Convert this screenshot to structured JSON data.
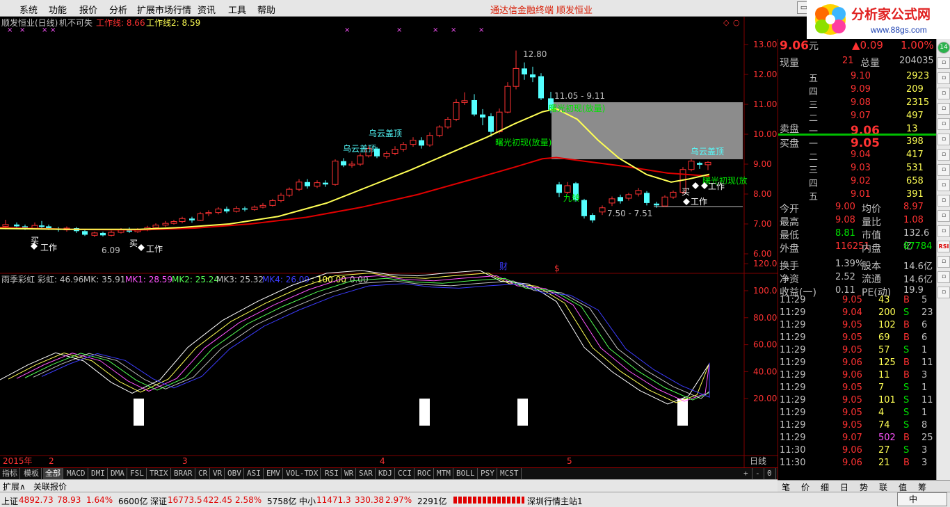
{
  "menu": [
    "系统",
    "功能",
    "报价",
    "分析",
    "扩展市场行情",
    "资讯",
    "工具",
    "帮助"
  ],
  "center_links": [
    "通达信金融终端",
    "顺发恒业"
  ],
  "window_button": "行",
  "logo": {
    "text": "分析家公式网",
    "url": "www.88gs.com"
  },
  "price_chart": {
    "header_name": "顺发恒业(日线)",
    "header_formula": "机不可失",
    "line1_label": "工作线: 8.66",
    "line2_label": "工作线2: 8.59",
    "y_ticks": [
      "13.00",
      "12.00",
      "11.00",
      "10.00",
      "9.00",
      "8.00",
      "7.00",
      "6.00"
    ],
    "annotations": {
      "high": "12.80",
      "low_left": "6.09",
      "range_top": "11.05 - 9.11",
      "range_bottom": "7.50 - 7.51",
      "cloud": "乌云盖顶",
      "dawn": "曙光初现(放量)",
      "dawn_short": "曙光初现(放",
      "work": "工作",
      "buy": "买",
      "nine": "九转"
    },
    "markers": [
      "财",
      "$"
    ],
    "colors": {
      "up": "#ff3232",
      "down": "#54ffff",
      "ma1": "#ffff54",
      "ma2": "#e00000"
    }
  },
  "rainbow": {
    "title": "雨季彩虹",
    "caihong": "彩虹: 46.96",
    "mk": "MK: 35.91",
    "mk1": "MK1: 28.59",
    "mk2": "MK2: 25.24",
    "mk3": "MK3: 25.32",
    "mk4": "MK4: 26.09",
    "lv1": ": 100.00",
    "lv2": ": 0.00",
    "y_ticks": [
      "120.00",
      "100.00",
      "80.00",
      "60.00",
      "40.00",
      "20.00"
    ]
  },
  "timeline": {
    "year": "2015年",
    "months": [
      "2",
      "3",
      "4",
      "5"
    ],
    "period": "日线"
  },
  "indicator_tabs": [
    "指标",
    "模板",
    "全部",
    "MACD",
    "DMI",
    "DMA",
    "FSL",
    "TRIX",
    "BRAR",
    "CR",
    "VR",
    "OBV",
    "ASI",
    "EMV",
    "VOL-TDX",
    "RSI",
    "WR",
    "SAR",
    "KDJ",
    "CCI",
    "ROC",
    "MTM",
    "BOLL",
    "PSY",
    "MCST"
  ],
  "tab_controls": [
    "+",
    "-",
    "0"
  ],
  "ext_tabs": [
    "扩展∧",
    "关联报价"
  ],
  "quote": {
    "price": "9.06",
    "unit": "元",
    "change": "▲0.09",
    "pct": "1.00%",
    "now_vol_label": "现量",
    "now_vol": "21",
    "total_vol_label": "总量",
    "total_vol": "204035",
    "sell_label": "卖盘",
    "buy_label": "买盘",
    "asks": [
      {
        "lvl": "五",
        "price": "9.10",
        "vol": "2923"
      },
      {
        "lvl": "四",
        "price": "9.09",
        "vol": "209"
      },
      {
        "lvl": "三",
        "price": "9.08",
        "vol": "2315"
      },
      {
        "lvl": "二",
        "price": "9.07",
        "vol": "497"
      },
      {
        "lvl": "一",
        "price": "9.06",
        "vol": "13"
      }
    ],
    "bids": [
      {
        "lvl": "一",
        "price": "9.05",
        "vol": "398"
      },
      {
        "lvl": "二",
        "price": "9.04",
        "vol": "417"
      },
      {
        "lvl": "三",
        "price": "9.03",
        "vol": "531"
      },
      {
        "lvl": "四",
        "price": "9.02",
        "vol": "658"
      },
      {
        "lvl": "五",
        "price": "9.01",
        "vol": "391"
      }
    ],
    "stats": [
      {
        "l1": "今开",
        "v1": "9.00",
        "l2": "均价",
        "v2": "8.97",
        "c1": "#ff3232",
        "c2": "#ff3232"
      },
      {
        "l1": "最高",
        "v1": "9.08",
        "l2": "量比",
        "v2": "1.08",
        "c1": "#ff3232",
        "c2": "#ff3232"
      },
      {
        "l1": "最低",
        "v1": "8.81",
        "l2": "市值",
        "v2": "132.6亿",
        "c1": "#00e600",
        "c2": "#c0c0c0"
      },
      {
        "l1": "外盘",
        "v1": "116251",
        "l2": "内盘",
        "v2": "87784",
        "c1": "#ff3232",
        "c2": "#00e600"
      },
      {
        "l1": "换手",
        "v1": "1.39%",
        "l2": "股本",
        "v2": "14.6亿",
        "c1": "#c0c0c0",
        "c2": "#c0c0c0"
      },
      {
        "l1": "净资",
        "v1": "2.52",
        "l2": "流通",
        "v2": "14.6亿",
        "c1": "#c0c0c0",
        "c2": "#c0c0c0"
      },
      {
        "l1": "收益(一)",
        "v1": "0.11",
        "l2": "PE(动)",
        "v2": "19.9",
        "c1": "#c0c0c0",
        "c2": "#c0c0c0"
      }
    ],
    "ticks": [
      {
        "t": "11:29",
        "p": "9.05",
        "v": "43",
        "bs": "B",
        "n": "5"
      },
      {
        "t": "11:29",
        "p": "9.04",
        "v": "200",
        "bs": "S",
        "n": "23"
      },
      {
        "t": "11:29",
        "p": "9.05",
        "v": "102",
        "bs": "B",
        "n": "6"
      },
      {
        "t": "11:29",
        "p": "9.05",
        "v": "69",
        "bs": "B",
        "n": "6"
      },
      {
        "t": "11:29",
        "p": "9.05",
        "v": "57",
        "bs": "S",
        "n": "1"
      },
      {
        "t": "11:29",
        "p": "9.06",
        "v": "125",
        "bs": "B",
        "n": "11"
      },
      {
        "t": "11:29",
        "p": "9.06",
        "v": "11",
        "bs": "B",
        "n": "3"
      },
      {
        "t": "11:29",
        "p": "9.05",
        "v": "7",
        "bs": "S",
        "n": "1"
      },
      {
        "t": "11:29",
        "p": "9.05",
        "v": "101",
        "bs": "S",
        "n": "11"
      },
      {
        "t": "11:29",
        "p": "9.05",
        "v": "4",
        "bs": "S",
        "n": "1"
      },
      {
        "t": "11:29",
        "p": "9.05",
        "v": "74",
        "bs": "S",
        "n": "8"
      },
      {
        "t": "11:29",
        "p": "9.07",
        "v": "502",
        "bs": "B",
        "n": "25"
      },
      {
        "t": "11:30",
        "p": "9.06",
        "v": "27",
        "bs": "S",
        "n": "3"
      },
      {
        "t": "11:30",
        "p": "9.06",
        "v": "21",
        "bs": "B",
        "n": "3"
      }
    ]
  },
  "info_tabs": [
    "笔",
    "价",
    "细",
    "日",
    "势",
    "联",
    "值",
    "筹"
  ],
  "right_tools": [
    "14",
    "",
    "",
    "",
    "",
    "",
    "",
    "",
    "",
    "",
    "",
    "",
    "",
    "RSI",
    "",
    "",
    ""
  ],
  "status": {
    "sh_label": "上证",
    "sh_val": "4892.73",
    "sh_chg": "78.93",
    "sh_pct": "1.64%",
    "sh_amt": "6600亿",
    "sz_label": "深证",
    "sz_val": "16773.5",
    "sz_chg": "422.45",
    "sz_pct": "2.58%",
    "sz_amt": "5758亿",
    "zx_label": "中小",
    "zx_val": "11471.3",
    "zx_chg": "330.38",
    "zx_pct": "2.97%",
    "zx_amt": "2291亿",
    "station": "深圳行情主站1",
    "ime": "中"
  }
}
